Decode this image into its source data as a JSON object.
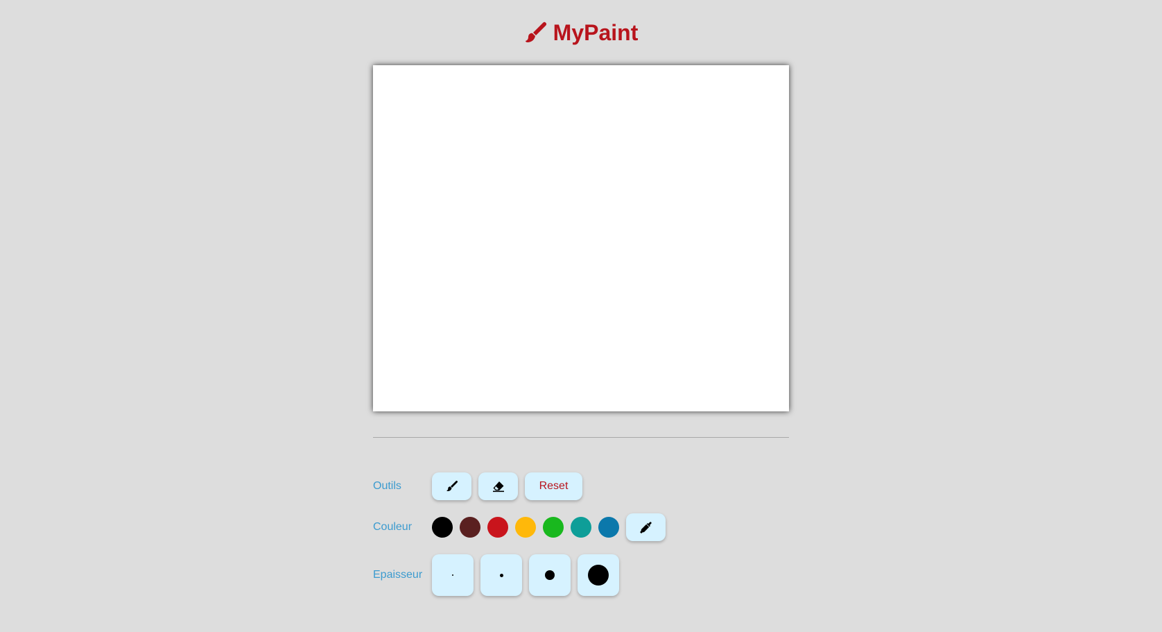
{
  "header": {
    "title": "MyPaint",
    "icon": "paint-brush-icon",
    "accent_color": "#b8141c"
  },
  "toolbar": {
    "tools_label": "Outils",
    "tools": [
      {
        "name": "brush",
        "icon": "paint-brush-icon"
      },
      {
        "name": "eraser",
        "icon": "eraser-icon"
      }
    ],
    "reset_label": "Reset",
    "color_label": "Couleur",
    "colors": [
      "#000000",
      "#5a2020",
      "#c9141c",
      "#ffb80a",
      "#19b81e",
      "#0e9e98",
      "#0b78ab"
    ],
    "picker_icon": "eyedropper-icon",
    "size_label": "Epaisseur",
    "sizes": [
      "extra-small",
      "small",
      "medium",
      "large"
    ]
  },
  "colors": {
    "background": "#dddddd",
    "label": "#3c9bcf",
    "button_bg": "#d6f2ff"
  }
}
